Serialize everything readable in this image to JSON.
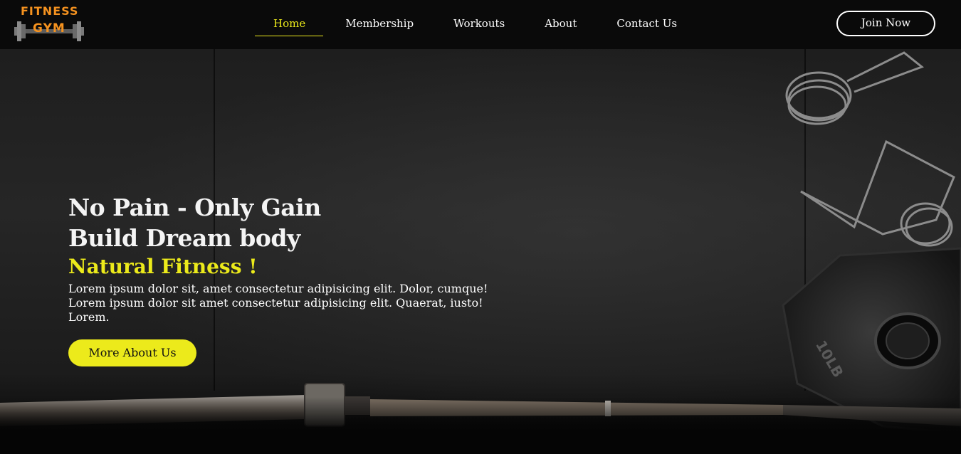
{
  "logo": {
    "line1": "FITNESS",
    "line2": "GYM",
    "icon": "dumbbell-icon",
    "color": "#f5921f"
  },
  "nav": {
    "items": [
      {
        "label": "Home",
        "active": true
      },
      {
        "label": "Membership",
        "active": false
      },
      {
        "label": "Workouts",
        "active": false
      },
      {
        "label": "About",
        "active": false
      },
      {
        "label": "Contact Us",
        "active": false
      }
    ],
    "accent": "#ecea1b"
  },
  "header": {
    "join_label": "Join Now"
  },
  "hero": {
    "line1": "No Pain - Only Gain",
    "line2": "Build Dream body",
    "subhead": "Natural Fitness !",
    "description": "Lorem ipsum dolor sit, amet consectetur adipisicing elit. Dolor, cumque! Lorem ipsum dolor sit amet consectetur adipisicing elit. Quaerat, iusto! Lorem.",
    "cta_label": "More About Us",
    "plate_label": "10LB",
    "background": "dark gym floor with barbell, weight plate and spring collars"
  }
}
